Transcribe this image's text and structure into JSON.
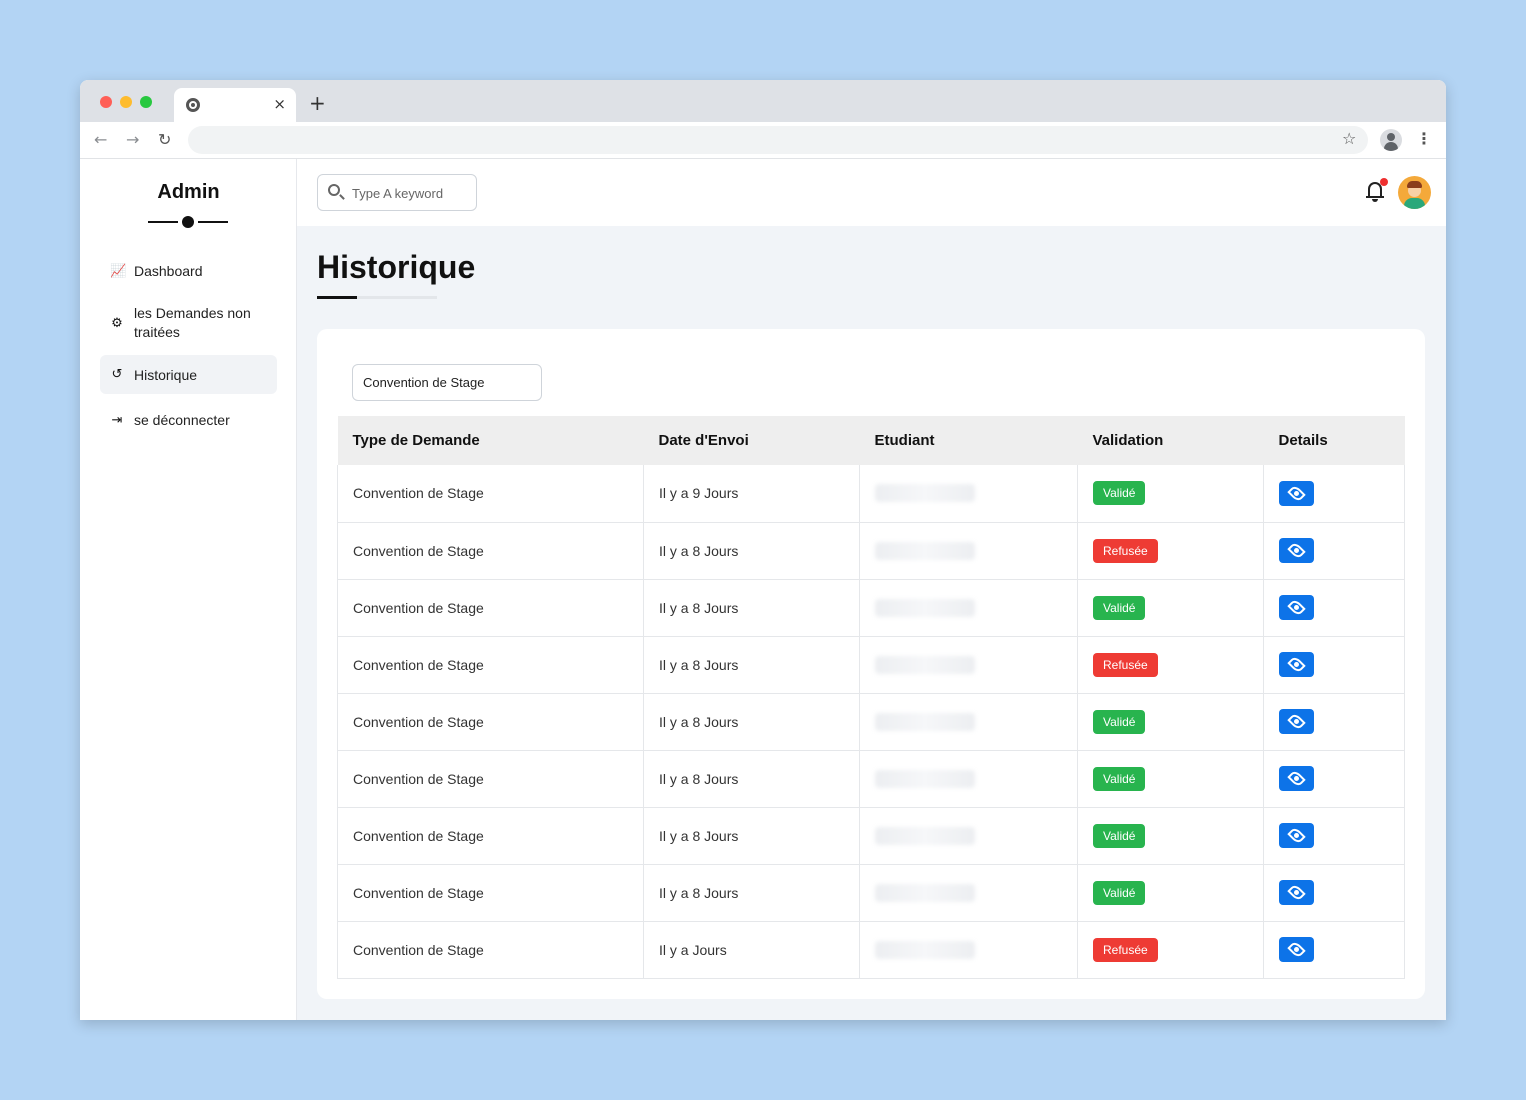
{
  "browser": {
    "close_glyph": "×",
    "new_tab_glyph": "+",
    "back_glyph": "←",
    "forward_glyph": "→",
    "reload_glyph": "↻",
    "star_glyph": "☆",
    "menu_glyph": "⋮"
  },
  "sidebar": {
    "brand": "Admin",
    "items": [
      {
        "label": "Dashboard",
        "icon": "chart-icon",
        "glyph": "📈"
      },
      {
        "label": "les Demandes non traitées",
        "icon": "gear-icon",
        "glyph": "⚙"
      },
      {
        "label": "Historique",
        "icon": "history-icon",
        "glyph": "↺"
      },
      {
        "label": "se déconnecter",
        "icon": "logout-icon",
        "glyph": "⇥"
      }
    ]
  },
  "topbar": {
    "search_placeholder": "Type A keyword"
  },
  "page": {
    "title": "Historique",
    "filter_value": "Convention de Stage"
  },
  "table": {
    "headers": [
      "Type de Demande",
      "Date d'Envoi",
      "Etudiant",
      "Validation",
      "Details"
    ],
    "rows": [
      {
        "type": "Convention de Stage",
        "date": "Il y a 9 Jours",
        "validation": "Validé",
        "status": "ok"
      },
      {
        "type": "Convention de Stage",
        "date": "Il y a 8 Jours",
        "validation": "Refusée",
        "status": "ko"
      },
      {
        "type": "Convention de Stage",
        "date": "Il y a 8 Jours",
        "validation": "Validé",
        "status": "ok"
      },
      {
        "type": "Convention de Stage",
        "date": "Il y a 8 Jours",
        "validation": "Refusée",
        "status": "ko"
      },
      {
        "type": "Convention de Stage",
        "date": "Il y a 8 Jours",
        "validation": "Validé",
        "status": "ok"
      },
      {
        "type": "Convention de Stage",
        "date": "Il y a 8 Jours",
        "validation": "Validé",
        "status": "ok"
      },
      {
        "type": "Convention de Stage",
        "date": "Il y a 8 Jours",
        "validation": "Validé",
        "status": "ok"
      },
      {
        "type": "Convention de Stage",
        "date": "Il y a 8 Jours",
        "validation": "Validé",
        "status": "ok"
      },
      {
        "type": "Convention de Stage",
        "date": "Il y a Jours",
        "validation": "Refusée",
        "status": "ko"
      }
    ]
  },
  "colors": {
    "accent": "#0d73e8",
    "valid": "#28b44e",
    "refused": "#ee3b34",
    "background": "#b3d4f4"
  }
}
